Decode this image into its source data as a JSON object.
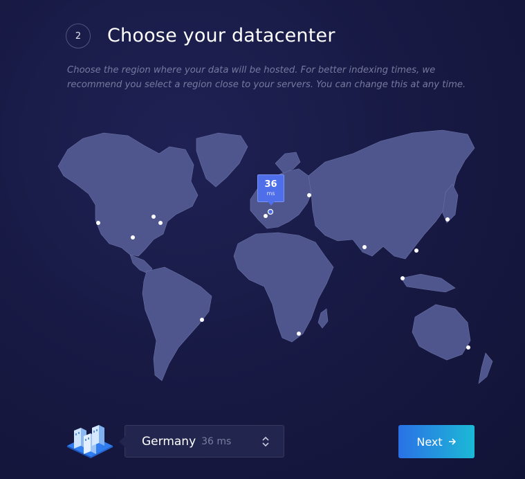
{
  "step": {
    "number": "2",
    "title": "Choose your datacenter"
  },
  "description": "Choose the region where your data will be hosted. For better indexing times, we recommend you select a region close to your servers. You can change this at any time.",
  "map": {
    "selected_latency": {
      "value": "36",
      "unit": "ms"
    },
    "colors": {
      "land": "#4e568d",
      "dot": "#ffffff",
      "selected": "#4f6fea"
    }
  },
  "region_select": {
    "country": "Germany",
    "latency": "36 ms"
  },
  "next_button": {
    "label": "Next",
    "icon": "arrow-right-icon"
  },
  "icons": {
    "illustration": "datacenter-buildings-icon",
    "select": "chevron-up-down-icon"
  }
}
